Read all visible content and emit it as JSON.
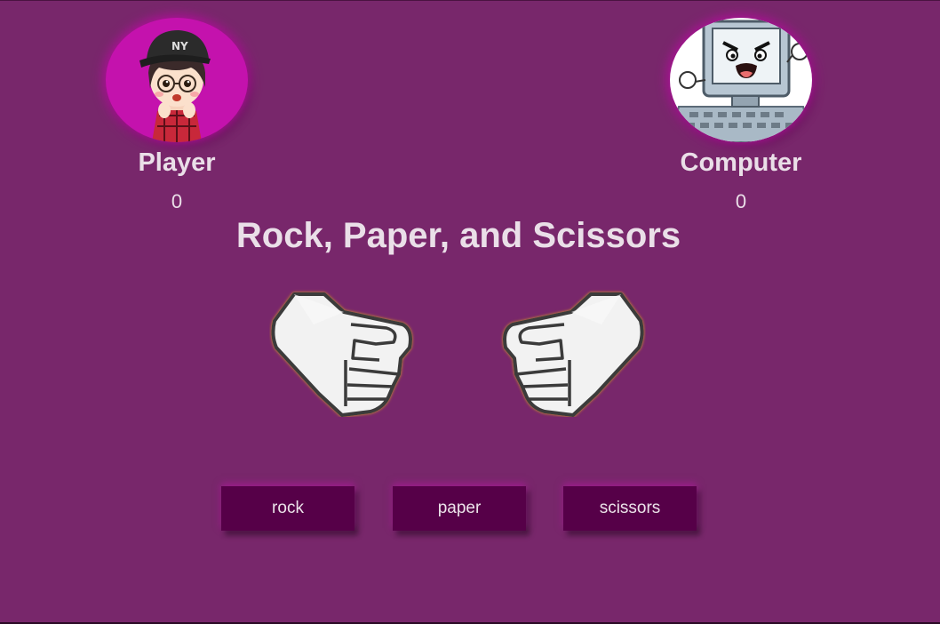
{
  "player": {
    "name": "Player",
    "score": "0",
    "avatar_icon": "boy-cap-avatar-icon",
    "avatar_bg": "#c412ad"
  },
  "computer": {
    "name": "Computer",
    "score": "0",
    "avatar_icon": "angry-computer-avatar-icon",
    "avatar_bg": "#ffffff"
  },
  "title": "Rock, Paper, and Scissors",
  "hands": {
    "player_icon": "fist-icon",
    "computer_icon": "fist-icon"
  },
  "buttons": {
    "rock": "rock",
    "paper": "paper",
    "scissors": "scissors"
  },
  "colors": {
    "background": "#78276b",
    "button": "#560048",
    "text": "#eadfe8"
  }
}
